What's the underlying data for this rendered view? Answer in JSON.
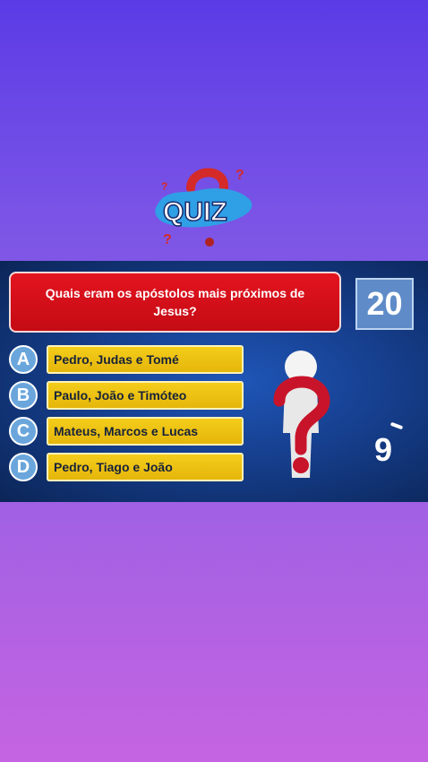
{
  "logo": {
    "text": "QUIZ"
  },
  "question": {
    "text": "Quais eram os apóstolos mais próximos de Jesus?"
  },
  "timer": {
    "value": "20"
  },
  "answers": [
    {
      "letter": "A",
      "text": "Pedro, Judas e Tomé"
    },
    {
      "letter": "B",
      "text": "Paulo, João e Timóteo"
    },
    {
      "letter": "C",
      "text": "Mateus, Marcos e Lucas"
    },
    {
      "letter": "D",
      "text": "Pedro, Tiago e João"
    }
  ],
  "countdown": {
    "value": "9"
  },
  "colors": {
    "question_bg": "#d0101a",
    "answer_bg": "#f0c416",
    "letter_bg": "#6aa6dc",
    "timer_bg": "#5f8cc8",
    "panel_bg": "#163f8e"
  }
}
